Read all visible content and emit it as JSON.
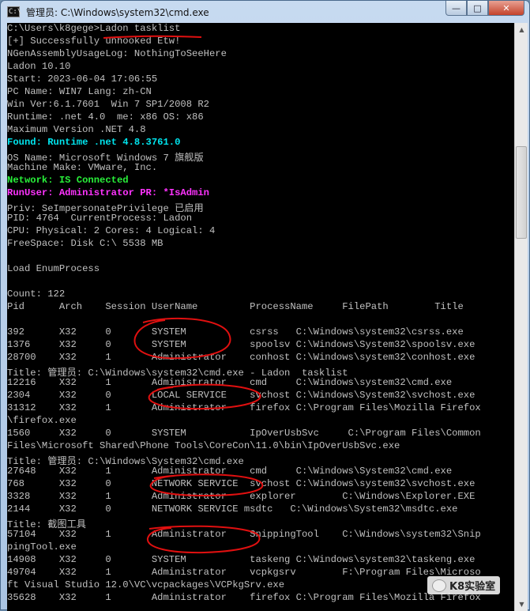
{
  "window": {
    "title": "管理员: C:\\Windows\\system32\\cmd.exe",
    "icon_label": "C:\\",
    "minimize": "—",
    "maximize": "□",
    "close": "✕"
  },
  "colors": {
    "console_bg": "#000000",
    "console_text": "#c0c0c0",
    "cyan": "#00e5ee",
    "green": "#29f03a",
    "magenta": "#ff33ff",
    "annotation_red": "#e01010"
  },
  "console": {
    "lines": [
      {
        "text": "C:\\Users\\k8gege>Ladon tasklist"
      },
      {
        "text": "[+] Successfully unhooked Etw!"
      },
      {
        "text": "NGenAssemblyUsageLog: NothingToSeeHere"
      },
      {
        "text": "Ladon 10.10"
      },
      {
        "text": "Start: 2023-06-04 17:06:55"
      },
      {
        "text": "PC Name: WIN7 Lang: zh-CN"
      },
      {
        "text": "Win Ver:6.1.7601  Win 7 SP1/2008 R2"
      },
      {
        "text": "Runtime: .net 4.0  me: x86 OS: x86"
      },
      {
        "text": "Maximum Version .NET 4.8"
      },
      {
        "text": "Found: Runtime .net 4.8.3761.0",
        "color": "cyan"
      },
      {
        "text": "OS Name: Microsoft Windows 7 旗舰版"
      },
      {
        "text": "Machine Make: VMware, Inc."
      },
      {
        "text": "Network: IS Connected",
        "color": "green"
      },
      {
        "text": "RunUser: Administrator PR: *IsAdmin",
        "color": "magenta"
      },
      {
        "text": "Priv: SeImpersonatePrivilege 已启用"
      },
      {
        "text": "PID: 4764  CurrentProcess: Ladon"
      },
      {
        "text": "CPU: Physical: 2 Cores: 4 Logical: 4"
      },
      {
        "text": "FreeSpace: Disk C:\\ 5538 MB"
      },
      {
        "text": ""
      },
      {
        "text": "Load EnumProcess"
      },
      {
        "text": ""
      },
      {
        "text": "Count: 122"
      },
      {
        "text": "Pid      Arch    Session UserName         ProcessName     FilePath        Title"
      },
      {
        "text": ""
      },
      {
        "text": "392      X32     0       SYSTEM           csrss   C:\\Windows\\system32\\csrss.exe"
      },
      {
        "text": "1376     X32     0       SYSTEM           spoolsv C:\\Windows\\System32\\spoolsv.exe"
      },
      {
        "text": "28700    X32     1       Administrator    conhost C:\\Windows\\system32\\conhost.exe"
      },
      {
        "text": "Title: 管理员: C:\\Windows\\system32\\cmd.exe - Ladon  tasklist"
      },
      {
        "text": "12216    X32     1       Administrator    cmd     C:\\Windows\\system32\\cmd.exe"
      },
      {
        "text": "2304     X32     0       LOCAL SERVICE    svchost C:\\Windows\\System32\\svchost.exe"
      },
      {
        "text": "31312    X32     1       Administrator    firefox C:\\Program Files\\Mozilla Firefox"
      },
      {
        "text": "\\firefox.exe"
      },
      {
        "text": "1560     X32     0       SYSTEM           IpOverUsbSvc     C:\\Program Files\\Common"
      },
      {
        "text": "Files\\Microsoft Shared\\Phone Tools\\CoreCon\\11.0\\bin\\IpOverUsbSvc.exe"
      },
      {
        "text": "Title: 管理员: C:\\Windows\\System32\\cmd.exe"
      },
      {
        "text": "27648    X32     1       Administrator    cmd     C:\\Windows\\System32\\cmd.exe"
      },
      {
        "text": "768      X32     0       NETWORK SERVICE  svchost C:\\Windows\\system32\\svchost.exe"
      },
      {
        "text": "3328     X32     1       Administrator    explorer        C:\\Windows\\Explorer.EXE"
      },
      {
        "text": "2144     X32     0       NETWORK SERVICE msdtc   C:\\Windows\\System32\\msdtc.exe"
      },
      {
        "text": "Title: 截图工具"
      },
      {
        "text": "57104    X32     1       Administrator    SnippingTool    C:\\Windows\\system32\\Snip"
      },
      {
        "text": "pingTool.exe"
      },
      {
        "text": "14908    X32     0       SYSTEM           taskeng C:\\Windows\\system32\\taskeng.exe"
      },
      {
        "text": "49704    X32     1       Administrator    vcpkgsrv        F:\\Program Files\\Microso"
      },
      {
        "text": "ft Visual Studio 12.0\\VC\\vcpackages\\VCPkgSrv.exe"
      },
      {
        "text": "35628    X32     1       Administrator    firefox C:\\Program Files\\Mozilla Firefox"
      }
    ]
  },
  "scrollbar": {
    "up": "▲",
    "down": "▼"
  },
  "watermark": {
    "text": "K8实验室"
  }
}
